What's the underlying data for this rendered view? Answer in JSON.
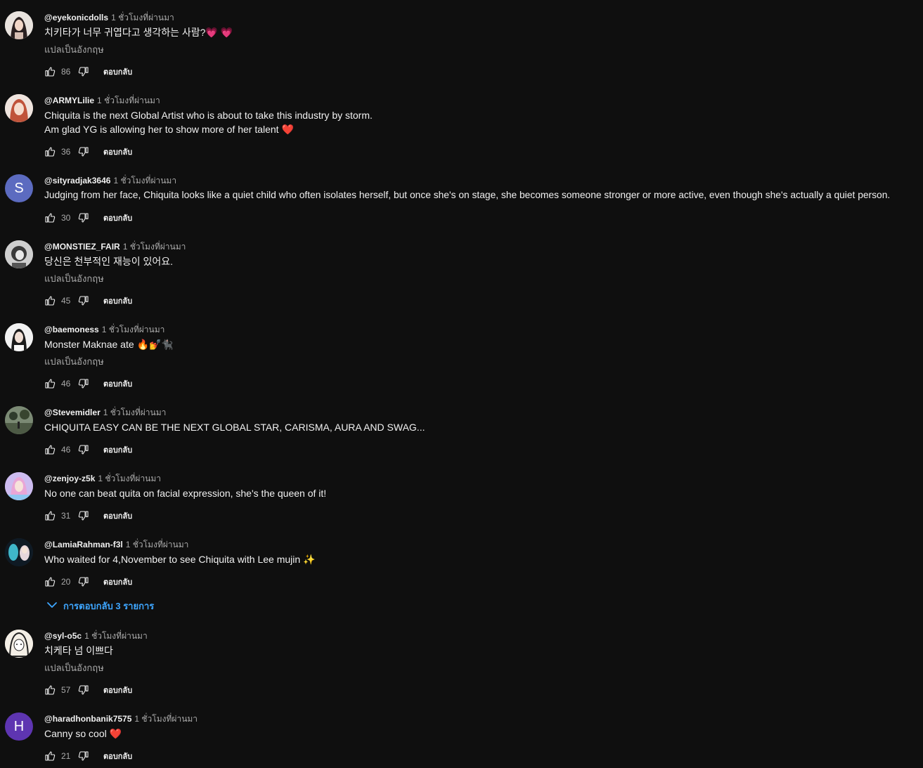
{
  "ui": {
    "translate_label": "แปลเป็นอังกฤษ",
    "reply_label": "ตอบกลับ",
    "replies_toggle": "การตอบกลับ 3 รายการ"
  },
  "comments": [
    {
      "author": "@eyekonicdolls",
      "time": "1 ชั่วโมงที่ผ่านมา",
      "text": "치키타가 너무 귀엽다고 생각하는 사람?💗 💗",
      "likes": "86"
    },
    {
      "author": "@ARMYLilie",
      "time": "1 ชั่วโมงที่ผ่านมา",
      "text_line1": "Chiquita is the next Global Artist who is about to take this industry by storm.",
      "text_line2": "Am glad YG is allowing her to show more of her talent ❤️",
      "likes": "36"
    },
    {
      "author": "@sityradjak3646",
      "time": "1 ชั่วโมงที่ผ่านมา",
      "avatar_letter": "S",
      "avatar_color": "#5c6bc0",
      "text": "Judging from her face, Chiquita looks like a quiet child who often isolates herself, but once she's on stage, she becomes someone stronger or more active, even though she's actually a quiet person.",
      "likes": "30"
    },
    {
      "author": "@MONSTIEZ_FAIR",
      "time": "1 ชั่วโมงที่ผ่านมา",
      "text": "당신은 천부적인 재능이 있어요.",
      "likes": "45"
    },
    {
      "author": "@baemoness",
      "time": "1 ชั่วโมงที่ผ่านมา",
      "text": "Monster Maknae ate 🔥💅🐈‍⬛",
      "likes": "46"
    },
    {
      "author": "@Stevemidler",
      "time": "1 ชั่วโมงที่ผ่านมา",
      "text": "CHIQUITA EASY CAN BE THE NEXT GLOBAL STAR, CARISMA, AURA AND SWAG...",
      "likes": "46"
    },
    {
      "author": "@zenjoy-z5k",
      "time": "1 ชั่วโมงที่ผ่านมา",
      "text": "No one can beat quita on facial expression, she's the queen of it!",
      "likes": "31"
    },
    {
      "author": "@LamiaRahman-f3l",
      "time": "1 ชั่วโมงที่ผ่านมา",
      "text": "Who waited for 4,November to see Chiquita with Lee mujin ✨",
      "likes": "20"
    },
    {
      "author": "@syl-o5c",
      "time": "1 ชั่วโมงที่ผ่านมา",
      "text": "치케타 넘 이쁘다",
      "likes": "57"
    },
    {
      "author": "@haradhonbanik7575",
      "time": "1 ชั่วโมงที่ผ่านมา",
      "avatar_letter": "H",
      "avatar_color": "#5e35b1",
      "text": "Canny so cool ❤️",
      "likes": "21"
    }
  ]
}
